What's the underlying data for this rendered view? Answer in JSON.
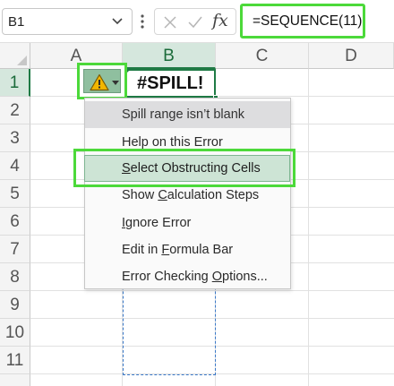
{
  "formula_bar": {
    "name_box": "B1",
    "fx_label": "fx",
    "formula": "=SEQUENCE(11)"
  },
  "columns": [
    "A",
    "B",
    "C",
    "D"
  ],
  "rows": [
    "1",
    "2",
    "3",
    "4",
    "5",
    "6",
    "7",
    "8",
    "9",
    "10",
    "11"
  ],
  "selected": {
    "column": "B",
    "row": "1"
  },
  "cell_b1": {
    "value": "#SPILL!"
  },
  "error_menu": {
    "header": "Spill range isn’t blank",
    "items": [
      {
        "pre": "Help on this Error",
        "u": "",
        "post": ""
      },
      {
        "pre": "",
        "u": "S",
        "post": "elect Obstructing Cells"
      },
      {
        "pre": "Show ",
        "u": "C",
        "post": "alculation Steps"
      },
      {
        "pre": "",
        "u": "I",
        "post": "gnore Error"
      },
      {
        "pre": "Edit in ",
        "u": "F",
        "post": "ormula Bar"
      },
      {
        "pre": "Error Checking ",
        "u": "O",
        "post": "ptions..."
      }
    ]
  },
  "colors": {
    "highlight_outline": "#4cd93a",
    "excel_green": "#1f7a45",
    "spill_border": "#3a79c9",
    "warning_yellow": "#f2b600"
  }
}
